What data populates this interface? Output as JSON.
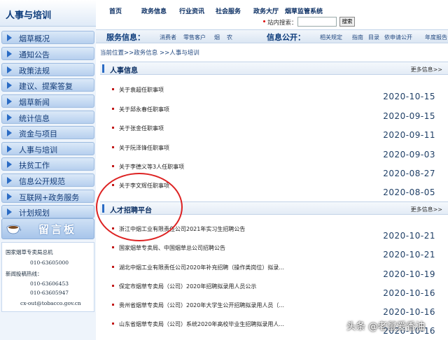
{
  "sidebar": {
    "title": "人事与培训",
    "items": [
      "烟草概况",
      "通知公告",
      "政策法规",
      "建议、提案答复",
      "烟草新闻",
      "统计信息",
      "资金与项目",
      "人事与培训",
      "扶贫工作",
      "信息公开规范",
      "互联网+政务服务",
      "计划规划"
    ],
    "guestbook": "留言板",
    "contact": {
      "org": "国家烟草专卖局总机",
      "phone": "010-63605000",
      "hotline_label": "新闻投稿热线：",
      "hotline1": "010-63606453",
      "hotline2": "010-63605947",
      "email": "cx-out@tobacco.gov.cn"
    }
  },
  "nav": {
    "items": [
      "首页",
      "政务信息",
      "行业资讯",
      "社会服务",
      "政务大厅",
      "烟草监管系统"
    ],
    "search_label": "站内搜索：",
    "search_value": "",
    "search_button": "搜索"
  },
  "service_bar": {
    "service_title": "服务信息：",
    "service_links": [
      "消费者",
      "零售客户",
      "烟",
      "农"
    ],
    "public_title": "信息公开：",
    "public_links": [
      "相关规定",
      "指南",
      "目录",
      "依申请公开",
      "年度报告"
    ]
  },
  "breadcrumb": "当前位置>>政务信息 >>人事与培训",
  "sections": [
    {
      "title": "人事信息",
      "more": "更多信息>>",
      "items": [
        {
          "text": "关于袁超任职事项",
          "date": "2020-10-15"
        },
        {
          "text": "关于邱永春任职事项",
          "date": "2020-09-15"
        },
        {
          "text": "关于张金任职事项",
          "date": "2020-09-11"
        },
        {
          "text": "关于阮泽锋任职事项",
          "date": "2020-09-03"
        },
        {
          "text": "关于李德义等3人任职事项",
          "date": "2020-08-27"
        },
        {
          "text": "关于李文辉任职事项",
          "date": "2020-08-05"
        }
      ]
    },
    {
      "title": "人才招聘平台",
      "more": "更多信息>>",
      "items": [
        {
          "text": "浙江中烟工业有限责任公司2021年实习生招聘公告",
          "date": "2020-10-21"
        },
        {
          "text": "国家烟草专卖局、中国烟草总公司招聘公告",
          "date": "2020-10-21"
        },
        {
          "text": "湖北中烟工业有限责任公司2020年补充招聘（操作类岗位）拟录...",
          "date": "2020-10-19"
        },
        {
          "text": "保定市烟草专卖局（公司）2020年招聘拟录用人员公示",
          "date": "2020-10-16"
        },
        {
          "text": "贵州省烟草专卖局（公司）2020年大学生公开招聘拟录用人员（...",
          "date": "2020-10-16"
        },
        {
          "text": "山东省烟草专卖局（公司）系统2020年高校毕业生招聘拟录用人...",
          "date": "2020-10-16"
        }
      ]
    }
  ],
  "watermark": "头条 @老鼠爱香油",
  "colors": {
    "accent": "#2a6bc4",
    "nav_text": "#0b2f63",
    "highlight_circle": "#d22222",
    "bullet": "#c21a1a"
  }
}
